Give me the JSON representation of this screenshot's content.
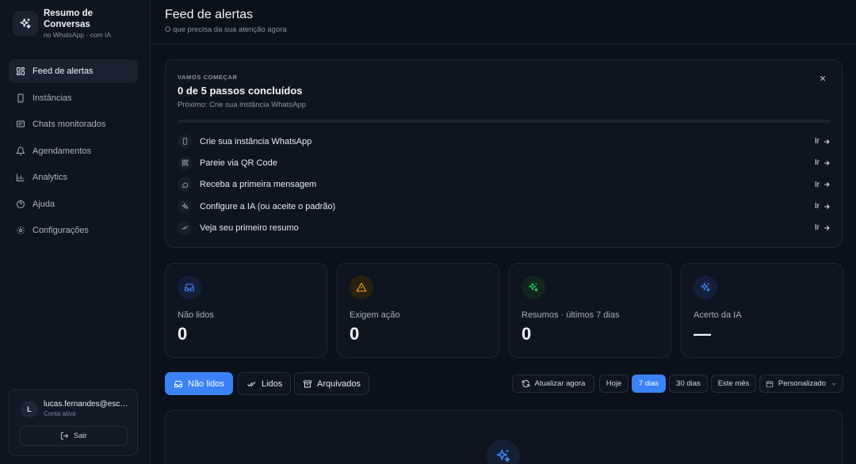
{
  "brand": {
    "title": "Resumo de Conversas",
    "subtitle": "no WhatsApp · com IA"
  },
  "nav": [
    {
      "label": "Feed de alertas",
      "icon": "grid-icon",
      "active": true
    },
    {
      "label": "Instâncias",
      "icon": "phone-icon"
    },
    {
      "label": "Chats monitorados",
      "icon": "chat-icon"
    },
    {
      "label": "Agendamentos",
      "icon": "bell-icon"
    },
    {
      "label": "Analytics",
      "icon": "bar-chart-icon"
    },
    {
      "label": "Ajuda",
      "icon": "help-icon"
    },
    {
      "label": "Configurações",
      "icon": "gear-icon"
    }
  ],
  "user": {
    "initial": "L",
    "email": "lucas.fernandes@escritorio.com",
    "status": "Conta ativa",
    "logout": "Sair"
  },
  "header": {
    "title": "Feed de alertas",
    "subtitle": "O que precisa da sua atenção agora"
  },
  "onboarding": {
    "kicker": "VAMOS COMEÇAR",
    "title": "0 de 5 passos concluídos",
    "next": "Próximo: Crie sua instância WhatsApp",
    "progress": 0,
    "go_label": "Ir",
    "steps": [
      {
        "label": "Crie sua instância WhatsApp",
        "icon": "phone-icon"
      },
      {
        "label": "Pareie via QR Code",
        "icon": "qr-icon"
      },
      {
        "label": "Receba a primeira mensagem",
        "icon": "chat-icon"
      },
      {
        "label": "Configure a IA (ou aceite o padrão)",
        "icon": "sparkle-icon"
      },
      {
        "label": "Veja seu primeiro resumo",
        "icon": "double-check-icon"
      }
    ]
  },
  "stats": [
    {
      "label": "Não lidos",
      "value": "0",
      "icon": "inbox-icon",
      "color": "#3b82f6"
    },
    {
      "label": "Exigem ação",
      "value": "0",
      "icon": "warning-icon",
      "color": "#f59e0b"
    },
    {
      "label": "Resumos · últimos 7 dias",
      "value": "0",
      "icon": "sparkle-icon",
      "color": "#22c55e"
    },
    {
      "label": "Acerto da IA",
      "value": "—",
      "icon": "sparkle-icon",
      "color": "#3b82f6"
    }
  ],
  "tabs": [
    {
      "label": "Não lidos",
      "icon": "inbox-icon",
      "active": true
    },
    {
      "label": "Lidos",
      "icon": "double-check-icon"
    },
    {
      "label": "Arquivados",
      "icon": "archive-icon"
    }
  ],
  "filters": {
    "refresh": "Atualizar agora",
    "ranges": [
      "Hoje",
      "7 dias",
      "30 dias",
      "Este mês"
    ],
    "active_range": "7 dias",
    "custom": "Personalizado"
  },
  "colors": {
    "accent": "#3b82f6",
    "background": "#0b111b",
    "sidebar": "#0e1420"
  }
}
